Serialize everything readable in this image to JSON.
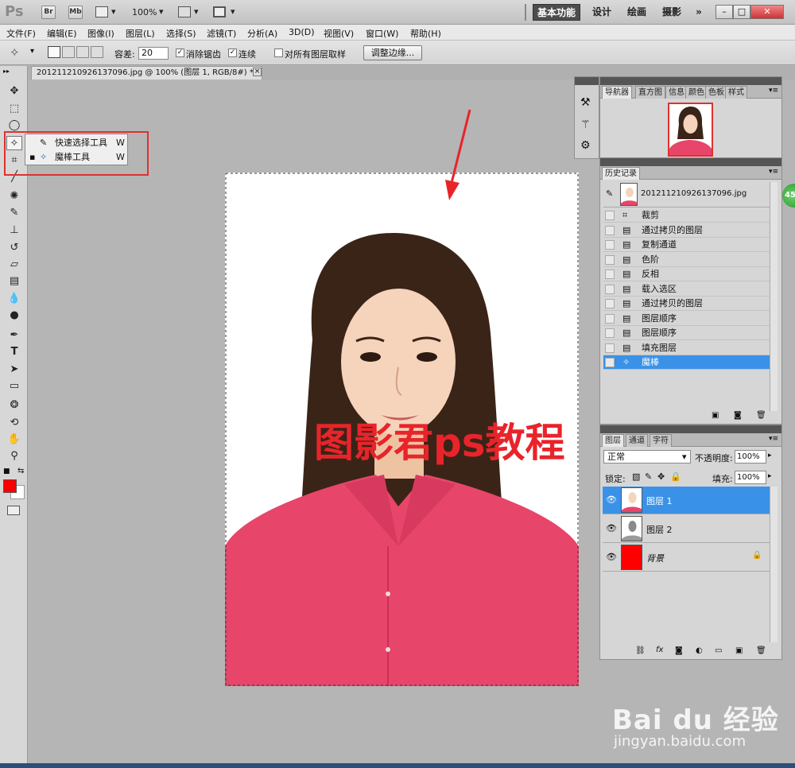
{
  "app": {
    "logo": "Ps",
    "br": "Br",
    "mb": "Mb",
    "zoom": "100%"
  },
  "workspaces": [
    {
      "label": "基本功能",
      "active": true
    },
    {
      "label": "设计"
    },
    {
      "label": "绘画"
    },
    {
      "label": "摄影"
    },
    {
      "label": "»"
    }
  ],
  "menu": [
    "文件(F)",
    "编辑(E)",
    "图像(I)",
    "图层(L)",
    "选择(S)",
    "滤镜(T)",
    "分析(A)",
    "3D(D)",
    "视图(V)",
    "窗口(W)",
    "帮助(H)"
  ],
  "options": {
    "tolerance_label": "容差:",
    "tolerance_value": "20",
    "antialias": "消除锯齿",
    "contiguous": "连续",
    "sample_all": "对所有图层取样",
    "refine": "调整边缘..."
  },
  "document": {
    "tab_title": "201211210926137096.jpg @ 100% (图层 1, RGB/8#) *",
    "close": "×"
  },
  "flyout": {
    "items": [
      {
        "label": "快速选择工具",
        "key": "W"
      },
      {
        "label": "魔棒工具",
        "key": "W",
        "current": true
      }
    ]
  },
  "navigator": {
    "tabs": [
      "导航器",
      "直方图",
      "信息",
      "颜色",
      "色板",
      "样式"
    ]
  },
  "history": {
    "tab": "历史记录",
    "snapshot": "201211210926137096.jpg",
    "items": [
      "裁剪",
      "通过拷贝的图层",
      "复制通道",
      "色阶",
      "反相",
      "载入选区",
      "通过拷贝的图层",
      "图层顺序",
      "图层顺序",
      "填充图层",
      "魔棒"
    ],
    "selected_index": 10
  },
  "layers": {
    "tabs": [
      "图层",
      "通道",
      "字符"
    ],
    "blend_mode": "正常",
    "opacity_label": "不透明度:",
    "opacity_value": "100%",
    "lock_label": "锁定:",
    "fill_label": "填充:",
    "fill_value": "100%",
    "items": [
      {
        "name": "图层 1",
        "selected": true
      },
      {
        "name": "图层 2"
      },
      {
        "name": "背景",
        "locked": true
      }
    ]
  },
  "overlay": {
    "watermark": "图影君ps教程",
    "badge": "45",
    "baidu_logo": "Bai du 经验",
    "baidu_url": "jingyan.baidu.com"
  },
  "colors": {
    "foreground": "#ff0000",
    "background": "#ffffff",
    "highlight": "#3a92e8",
    "accent_red": "#e8242a"
  }
}
